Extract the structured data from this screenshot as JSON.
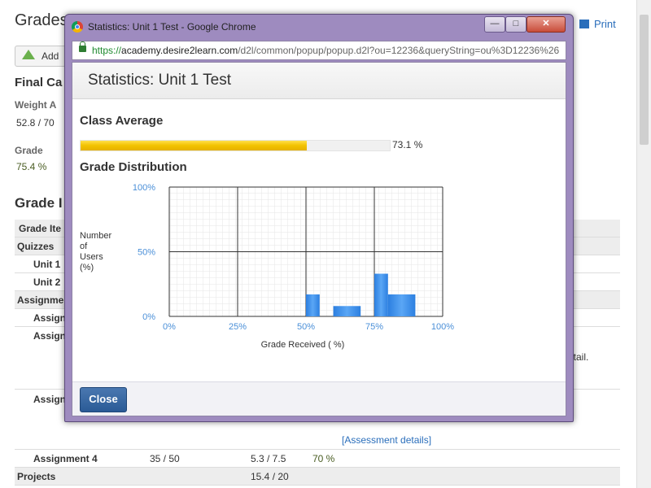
{
  "background": {
    "title": "Grades",
    "print_label": "Print",
    "add_label": "Add",
    "final_calc_heading": "Final Ca",
    "weight_label": "Weight A",
    "weight_value": "52.8 / 70",
    "grade_label": "Grade",
    "grade_value": "75.4 %",
    "grade_items_heading": "Grade I",
    "table": {
      "header": "Grade Ite",
      "rows": [
        {
          "name": "Quizzes",
          "points": "",
          "weight": "",
          "grade": ""
        },
        {
          "name": "Unit 1",
          "points": "",
          "weight": "",
          "grade": ""
        },
        {
          "name": "Unit 2",
          "points": "",
          "weight": "",
          "grade": ""
        },
        {
          "name": "Assignme",
          "points": "",
          "weight": "",
          "grade": ""
        },
        {
          "name": "Assign",
          "points": "",
          "weight": "",
          "grade": ""
        },
        {
          "name": "Assign",
          "points": "",
          "weight": "",
          "grade": ""
        },
        {
          "name": "Assign",
          "points": "",
          "weight": "",
          "grade": ""
        },
        {
          "name": "Assignment 4",
          "points": "35 / 50",
          "weight": "5.3 / 7.5",
          "grade": "70 %"
        },
        {
          "name": "Projects",
          "points": "",
          "weight": "15.4 / 20",
          "grade": ""
        }
      ],
      "detail_fragment": "etail.",
      "assessment_link": "[Assessment details]"
    }
  },
  "popup": {
    "window_title": "Statistics: Unit 1 Test - Google Chrome",
    "url_scheme": "https://",
    "url_host": "academy.desire2learn.com",
    "url_path": "/d2l/common/popup/popup.d2l?ou=12236&queryString=ou%3D12236%26",
    "dialog_title": "Statistics: Unit 1 Test",
    "class_average_heading": "Class Average",
    "class_average_value": "73.1 %",
    "class_average_fraction": 0.731,
    "distribution_heading": "Grade Distribution",
    "close_label": "Close",
    "colors": {
      "bar": "#3a8ee8",
      "progress": "#f2c200",
      "button": "#2a5a96"
    }
  },
  "chart_data": {
    "type": "bar",
    "xlabel": "Grade Received ( %)",
    "ylabel": "Number of Users (%)",
    "ylabel_lines": [
      "Number",
      "of",
      "Users",
      "(%)"
    ],
    "x_ticks": [
      "0%",
      "25%",
      "50%",
      "75%",
      "100%"
    ],
    "y_ticks": [
      "0%",
      "50%",
      "100%"
    ],
    "xlim": [
      0,
      100
    ],
    "ylim": [
      0,
      100
    ],
    "grid": true,
    "bins": [
      {
        "x0": 50,
        "x1": 55,
        "value": 17
      },
      {
        "x0": 60,
        "x1": 70,
        "value": 8
      },
      {
        "x0": 75,
        "x1": 80,
        "value": 33
      },
      {
        "x0": 80,
        "x1": 90,
        "value": 17
      }
    ]
  }
}
